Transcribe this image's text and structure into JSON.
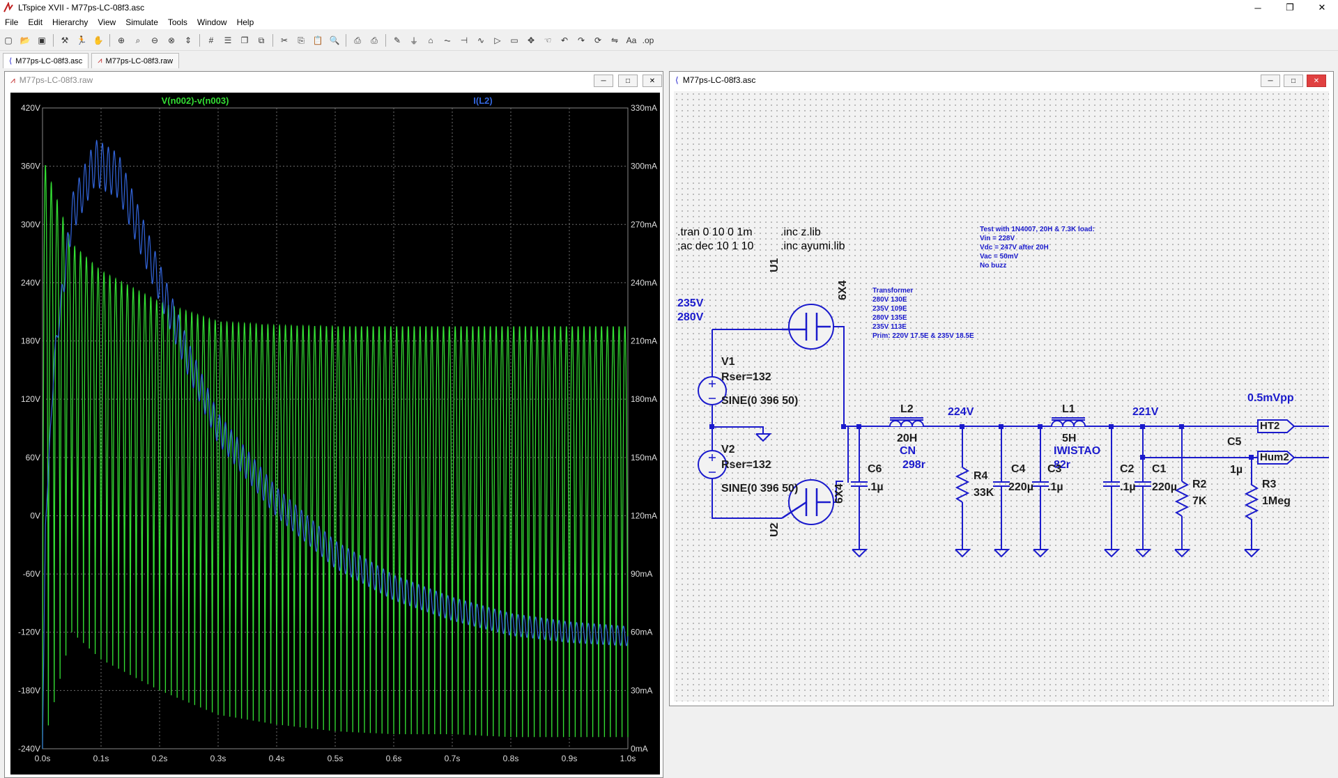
{
  "window": {
    "title": "LTspice XVII - M77ps-LC-08f3.asc",
    "minimize": "─",
    "restore": "❐",
    "close": "✕"
  },
  "menu": [
    "File",
    "Edit",
    "Hierarchy",
    "View",
    "Simulate",
    "Tools",
    "Window",
    "Help"
  ],
  "toolbar_icons": [
    "new-icon",
    "open-icon",
    "save-icon",
    "control-panel-icon",
    "run-icon",
    "halt-icon",
    "zoom-in-icon",
    "zoom-area-icon",
    "zoom-out-icon",
    "zoom-fit-icon",
    "autorange-icon",
    "grid-icon",
    "tile-icon",
    "cascade-icon",
    "close-all-icon",
    "cut-icon",
    "copy-icon",
    "paste-icon",
    "find-icon",
    "print-icon",
    "print-preview-icon",
    "wire-icon",
    "ground-icon",
    "label-icon",
    "resistor-icon",
    "capacitor-icon",
    "inductor-icon",
    "diode-icon",
    "component-icon",
    "move-icon",
    "drag-icon",
    "undo-icon",
    "redo-icon",
    "rotate-icon",
    "mirror-icon",
    "text-icon",
    "spice-directive-icon"
  ],
  "tabs": [
    {
      "label": "M77ps-LC-08f3.asc",
      "icon": "schematic-icon"
    },
    {
      "label": "M77ps-LC-08f3.raw",
      "icon": "waveform-icon"
    }
  ],
  "waveform_window": {
    "title": "M77ps-LC-08f3.raw",
    "minimize": "─",
    "restore": "□",
    "close": "✕"
  },
  "schematic_window": {
    "title": "M77ps-LC-08f3.asc",
    "minimize": "─",
    "restore": "□",
    "close": "✕"
  },
  "colors": {
    "trace_voltage": "#33dd33",
    "trace_current": "#3366dd",
    "plot_bg": "#000000",
    "schematic_blue": "#1a1acc",
    "wire": "#1a1acc",
    "grid_line": "#707070"
  },
  "chart_data": {
    "type": "line",
    "series": [
      {
        "name": "V(n002)-v(n003)",
        "axis": "left",
        "color": "#33dd33",
        "description_of_shape": "full-wave rectified oscillation",
        "envelope_upper": [
          [
            0.0,
            370
          ],
          [
            0.05,
            280
          ],
          [
            0.1,
            252
          ],
          [
            0.2,
            220
          ],
          [
            0.3,
            200
          ],
          [
            0.4,
            196
          ],
          [
            0.5,
            195
          ],
          [
            0.6,
            195
          ],
          [
            0.7,
            195
          ],
          [
            0.8,
            195
          ],
          [
            0.9,
            195
          ],
          [
            1.0,
            195
          ]
        ],
        "envelope_lower": [
          [
            0.0,
            -240
          ],
          [
            0.05,
            -120
          ],
          [
            0.1,
            -148
          ],
          [
            0.2,
            -180
          ],
          [
            0.3,
            -205
          ],
          [
            0.4,
            -215
          ],
          [
            0.5,
            -222
          ],
          [
            0.6,
            -225
          ],
          [
            0.7,
            -225
          ],
          [
            0.8,
            -228
          ],
          [
            0.9,
            -228
          ],
          [
            1.0,
            -228
          ]
        ],
        "cycles_per_second": 100
      },
      {
        "name": "I(L2)",
        "axis": "right",
        "color": "#3366dd",
        "center": [
          [
            0.0,
            0
          ],
          [
            0.005,
            115
          ],
          [
            0.02,
            200
          ],
          [
            0.05,
            275
          ],
          [
            0.09,
            302
          ],
          [
            0.13,
            295
          ],
          [
            0.2,
            240
          ],
          [
            0.25,
            200
          ],
          [
            0.3,
            165
          ],
          [
            0.4,
            127
          ],
          [
            0.5,
            100
          ],
          [
            0.6,
            83
          ],
          [
            0.7,
            72
          ],
          [
            0.8,
            64
          ],
          [
            0.9,
            60
          ],
          [
            1.0,
            58
          ]
        ],
        "ripple": [
          [
            0.0,
            0
          ],
          [
            0.05,
            10
          ],
          [
            0.1,
            12
          ],
          [
            0.2,
            10
          ],
          [
            0.3,
            8
          ],
          [
            0.5,
            7
          ],
          [
            0.7,
            6
          ],
          [
            1.0,
            5
          ]
        ]
      }
    ],
    "x": {
      "min": 0,
      "max": 1.0,
      "ticks": [
        "0.0s",
        "0.1s",
        "0.2s",
        "0.3s",
        "0.4s",
        "0.5s",
        "0.6s",
        "0.7s",
        "0.8s",
        "0.9s",
        "1.0s"
      ]
    },
    "y_left": {
      "min": -240,
      "max": 420,
      "ticks": [
        "420V",
        "360V",
        "300V",
        "240V",
        "180V",
        "120V",
        "60V",
        "0V",
        "-60V",
        "-120V",
        "-180V",
        "-240V"
      ]
    },
    "y_right": {
      "min": 0,
      "max": 330,
      "ticks": [
        "330mA",
        "300mA",
        "270mA",
        "240mA",
        "210mA",
        "180mA",
        "150mA",
        "120mA",
        "90mA",
        "60mA",
        "30mA",
        "0mA"
      ]
    },
    "grid": true
  },
  "schematic": {
    "directives": {
      "tran": ".tran 0 10 0 1m",
      "ac": ";ac dec 10 1 10",
      "inc1": ".inc z.lib",
      "inc2": ".inc ayumi.lib"
    },
    "test_note": [
      "Test with 1N4007, 20H & 7.3K load:",
      "Vin = 228V",
      "Vdc = 247V after 20H",
      "Vac = 50mV",
      "No buzz"
    ],
    "transformer_note": [
      "Transformer",
      "280V 130E",
      "235V 109E",
      "280V 135E",
      "235V 113E",
      "Prim: 220V 17.5E & 235V 18.5E"
    ],
    "components": {
      "U1": {
        "name": "U1",
        "value": "6X4"
      },
      "U2": {
        "name": "U2",
        "value": "6X4"
      },
      "V1": {
        "name": "V1",
        "rser": "Rser=132",
        "source": "SINE(0 396 50)"
      },
      "V2": {
        "name": "V2",
        "rser": "Rser=132",
        "source": "SINE(0 396 50)"
      },
      "L2": {
        "name": "L2",
        "value": "20H",
        "part": "CN",
        "rser": "298r"
      },
      "L1": {
        "name": "L1",
        "value": "5H",
        "part": "IWISTAO",
        "rser": "82r"
      },
      "C6": {
        "name": "C6",
        "value": ".1µ"
      },
      "R4": {
        "name": "R4",
        "value": "33K"
      },
      "C4": {
        "name": "C4",
        "value": "220µ"
      },
      "C3": {
        "name": "C3",
        "value": ".1µ"
      },
      "C2": {
        "name": "C2",
        "value": ".1µ"
      },
      "C1": {
        "name": "C1",
        "value": "220µ"
      },
      "R2": {
        "name": "R2",
        "value": "7K"
      },
      "C5": {
        "name": "C5",
        "value": "1µ"
      },
      "R3": {
        "name": "R3",
        "value": "1Meg"
      }
    },
    "labels": {
      "v_235": "235V",
      "v_280": "280V",
      "v_224": "224V",
      "v_221": "221V",
      "ripple": "0.5mVpp",
      "ht2": "HT2",
      "hum2": "Hum2"
    }
  }
}
